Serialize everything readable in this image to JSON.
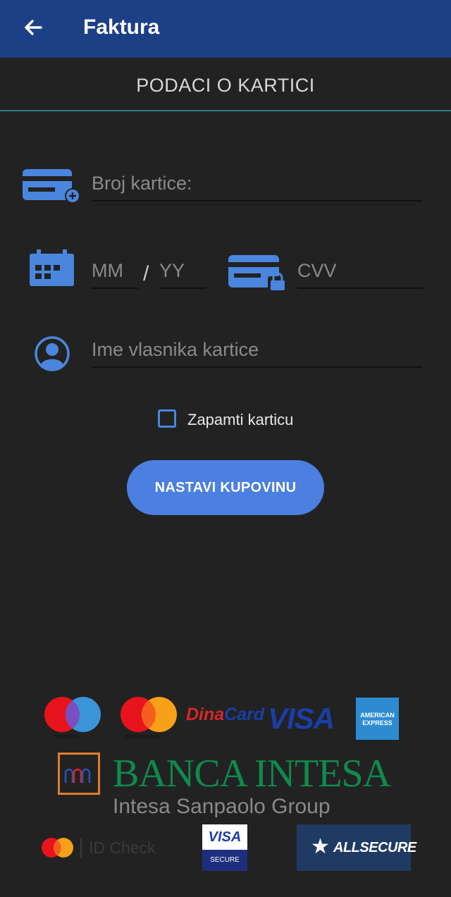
{
  "header": {
    "title": "Faktura"
  },
  "section": {
    "title": "PODACI O KARTICI"
  },
  "form": {
    "card_number_placeholder": "Broj kartice:",
    "month_placeholder": "MM",
    "year_placeholder": "YY",
    "separator": "/",
    "cvv_placeholder": "CVV",
    "holder_placeholder": "Ime vlasnika kartice",
    "remember_label": "Zapamti karticu",
    "remember_checked": false,
    "submit_label": "NASTAVI KUPOVINU"
  },
  "logos": {
    "maestro": "maestro",
    "mastercard": "mastercard",
    "dinacard_dina": "Dina",
    "dinacard_card": "Card",
    "visa": "VISA",
    "amex": "AMERICAN EXPRESS",
    "banca": "BANCA INTESA",
    "banca_sub": "Intesa Sanpaolo Group",
    "id_check": "ID Check",
    "visa_secure_top": "VISA",
    "visa_secure_bottom": "SECURE",
    "allsecure": "ALLSECURE"
  },
  "colors": {
    "appbar": "#1d3f86",
    "background": "#222222",
    "accent": "#4b7fe0",
    "icon": "#4b86de",
    "divider": "#2f7f86"
  }
}
